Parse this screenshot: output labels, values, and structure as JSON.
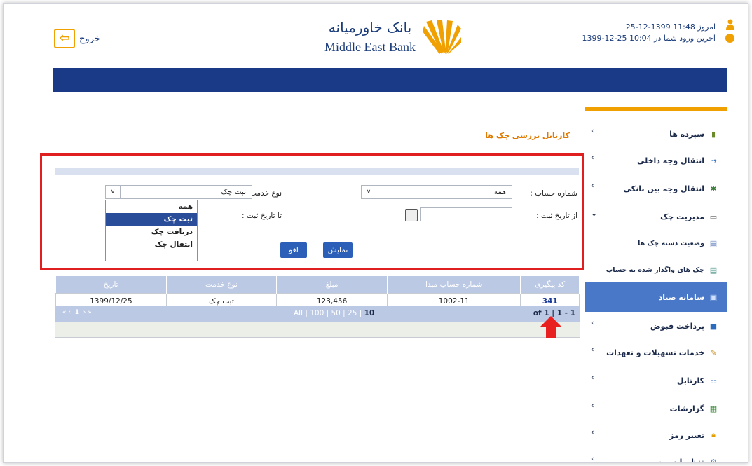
{
  "header": {
    "logout_label": "خروج",
    "logo_fa": "بانک خاورمیانه",
    "logo_en": "Middle East Bank",
    "today_label": "امروز 11:48 1399-12-25",
    "last_login_label": "آخرین ورود شما در 10:04 25-12-1399",
    "accent_color": "#f0a000",
    "brand_color": "#1a3a88"
  },
  "sidebar": {
    "items": [
      {
        "label": "سپرده ها",
        "icon": "money-stack-icon"
      },
      {
        "label": "انتقال وجه داخلی",
        "icon": "transfer-icon"
      },
      {
        "label": "انتقال وجه بین بانکی",
        "icon": "interbank-icon"
      },
      {
        "label": "مدیریت چک",
        "icon": "cheque-icon"
      },
      {
        "label": "وضعیت دسته چک ها",
        "icon": "chequebook-icon"
      },
      {
        "label": "چک های واگذار شده به حساب",
        "icon": "assigned-cheque-icon"
      },
      {
        "label": "سامانه صیاد",
        "icon": "sayad-icon"
      },
      {
        "label": "پرداخت قبوض",
        "icon": "bill-icon"
      },
      {
        "label": "خدمات تسهیلات و تعهدات",
        "icon": "loan-icon"
      },
      {
        "label": "کارتابل",
        "icon": "cartable-icon"
      },
      {
        "label": "گزارشات",
        "icon": "report-icon"
      },
      {
        "label": "تغییر رمز",
        "icon": "lock-icon"
      },
      {
        "label": "تنظیمات من",
        "icon": "settings-icon"
      }
    ]
  },
  "main": {
    "title": "کارتابل بررسی چک ها",
    "filters": {
      "account_label": "شماره حساب :",
      "account_value": "همه",
      "service_label": "نوع خدمت :",
      "service_value": "ثبت چک",
      "service_options": [
        "همه",
        "ثبت چک",
        "دریافت چک",
        "انتقال چک"
      ],
      "from_date_label": "از تاریخ ثبت :",
      "to_date_label": "تا تاریخ ثبت :",
      "show_button": "نمایش",
      "cancel_button": "لغو"
    },
    "table": {
      "headers": [
        "تاریخ",
        "نوع خدمت",
        "مبلغ",
        "شماره حساب مبدا",
        "کد پیگیری"
      ],
      "rows": [
        [
          "1399/12/25",
          "ثبت چک",
          "123,456",
          "1002-11",
          "341"
        ]
      ]
    },
    "pager": {
      "nav": "« ‹ 1 › »",
      "current_page": "1",
      "sizes_prefix": "All | 100 | 50 | 25 |",
      "size_current": "10",
      "of_text": "of 1 | 1 - 1"
    }
  }
}
